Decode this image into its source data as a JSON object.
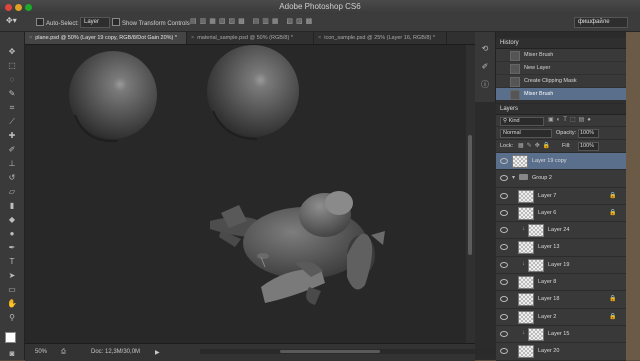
{
  "window": {
    "title": "Adobe Photoshop CS6",
    "workspace": "фишфайле"
  },
  "options_bar": {
    "auto_select_label": "Auto-Select:",
    "auto_select_value": "Layer",
    "transform_controls_label": "Show Transform Controls"
  },
  "tabs": [
    {
      "label": "plane.psd @ 50% (Layer 19 copy, RGB/8/Dot Gain 20%) *",
      "active": true
    },
    {
      "label": "material_sample.psd @ 50% (RGB/8) *",
      "active": false
    },
    {
      "label": "icon_sample.psd @ 25% (Layer 16, RGB/8) *",
      "active": false
    }
  ],
  "status_bar": {
    "zoom": "50%",
    "doc": "Doc: 12,3M/30,0M"
  },
  "history": {
    "title": "History",
    "items": [
      {
        "label": "Mixer Brush",
        "active": false
      },
      {
        "label": "New Layer",
        "active": false
      },
      {
        "label": "Create Clipping Mask",
        "active": false
      },
      {
        "label": "Mixer Brush",
        "active": true
      }
    ]
  },
  "layers": {
    "title": "Layers",
    "filter_kind": "Kind",
    "blend_mode": "Normal",
    "opacity_label": "Opacity:",
    "opacity_value": "100%",
    "lock_label": "Lock:",
    "fill_label": "Fill:",
    "fill_value": "100%",
    "items": [
      {
        "name": "Layer 19 copy",
        "selected": true,
        "indent": 0,
        "locked": false,
        "clipped": false,
        "group": false
      },
      {
        "name": "Group 2",
        "selected": false,
        "indent": 0,
        "locked": false,
        "clipped": false,
        "group": true
      },
      {
        "name": "Layer 7",
        "selected": false,
        "indent": 1,
        "locked": true,
        "clipped": false,
        "group": false
      },
      {
        "name": "Layer 6",
        "selected": false,
        "indent": 1,
        "locked": true,
        "clipped": false,
        "group": false
      },
      {
        "name": "Layer 24",
        "selected": false,
        "indent": 2,
        "locked": false,
        "clipped": true,
        "group": false
      },
      {
        "name": "Layer 13",
        "selected": false,
        "indent": 1,
        "locked": false,
        "clipped": false,
        "group": false
      },
      {
        "name": "Layer 19",
        "selected": false,
        "indent": 2,
        "locked": false,
        "clipped": true,
        "group": false
      },
      {
        "name": "Layer 8",
        "selected": false,
        "indent": 1,
        "locked": false,
        "clipped": false,
        "group": false
      },
      {
        "name": "Layer 18",
        "selected": false,
        "indent": 1,
        "locked": true,
        "clipped": false,
        "group": false
      },
      {
        "name": "Layer 2",
        "selected": false,
        "indent": 1,
        "locked": true,
        "clipped": false,
        "group": false
      },
      {
        "name": "Layer 15",
        "selected": false,
        "indent": 2,
        "locked": false,
        "clipped": true,
        "group": false
      },
      {
        "name": "Layer 20",
        "selected": false,
        "indent": 1,
        "locked": false,
        "clipped": false,
        "group": false
      }
    ]
  },
  "colors": {
    "accent_selected": "#5a6f8c"
  }
}
